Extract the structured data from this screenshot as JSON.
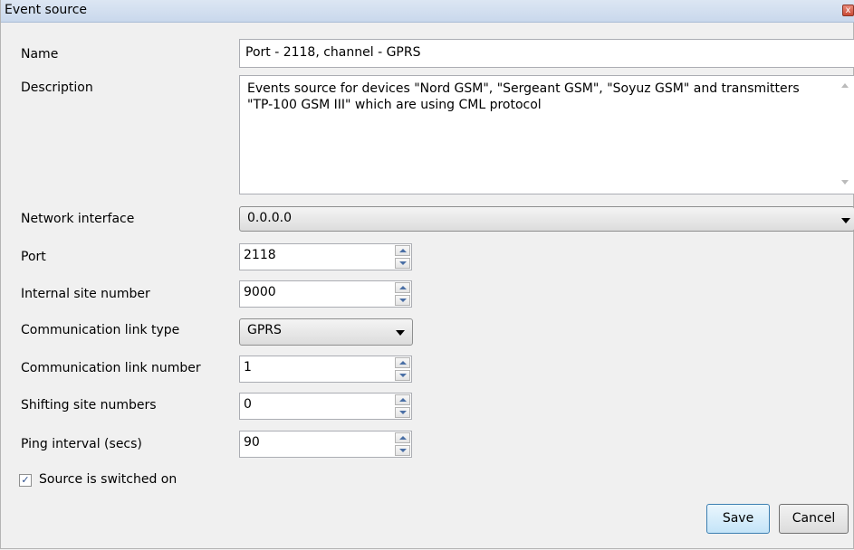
{
  "window": {
    "title": "Event source",
    "close_glyph": "x"
  },
  "form": {
    "name": {
      "label": "Name",
      "value": "Port - 2118, channel - GPRS"
    },
    "description": {
      "label": "Description",
      "value": "Events source for devices \"Nord GSM\", \"Sergeant GSM\", \"Soyuz GSM\" and transmitters \"TP-100 GSM III\" which are using CML protocol"
    },
    "network_interface": {
      "label": "Network interface",
      "value": "0.0.0.0"
    },
    "port": {
      "label": "Port",
      "value": "2118"
    },
    "internal_site_number": {
      "label": "Internal site number",
      "value": "9000"
    },
    "communication_link_type": {
      "label": "Communication link type",
      "value": "GPRS"
    },
    "communication_link_number": {
      "label": "Communication link number",
      "value": "1"
    },
    "shifting_site_numbers": {
      "label": "Shifting site numbers",
      "value": "0"
    },
    "ping_interval": {
      "label": "Ping interval (secs)",
      "value": "90"
    },
    "switched_on": {
      "label": "Source is switched on",
      "checked": true,
      "glyph": "✓"
    }
  },
  "buttons": {
    "save": "Save",
    "cancel": "Cancel"
  },
  "colors": {
    "title_bar": "#c9d8ec",
    "background": "#f0f0f0",
    "close_button": "#c94a35"
  }
}
